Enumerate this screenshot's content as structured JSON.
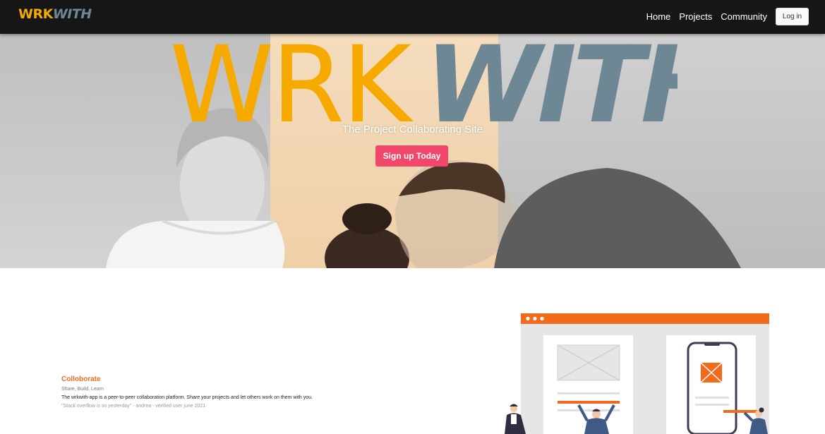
{
  "navbar": {
    "brand": {
      "part1": "WRK",
      "part2": "WITH"
    },
    "links": [
      "Home",
      "Projects",
      "Community"
    ],
    "login_label": "Log in"
  },
  "hero": {
    "logo": {
      "part1": "WRK",
      "part2": "WITH"
    },
    "tagline": "The Project Collaborating Site",
    "cta_label": "Sign up Today"
  },
  "feature": {
    "title": "Colloborate",
    "subtitle": "Share, Build, Learn",
    "description": "The wrkwith-app is a peer-to-peer collaboration platform. Share your projects and let others work on them with you.",
    "quote": "\"Stack overflow is so yesterday\" - andrea - verified user june 2021"
  },
  "colors": {
    "nav_bg": "#161616",
    "brand_orange": "#f2a900",
    "brand_slate": "#6e8794",
    "cta_pink": "#f0476a",
    "accent_orange": "#f26b1d"
  }
}
